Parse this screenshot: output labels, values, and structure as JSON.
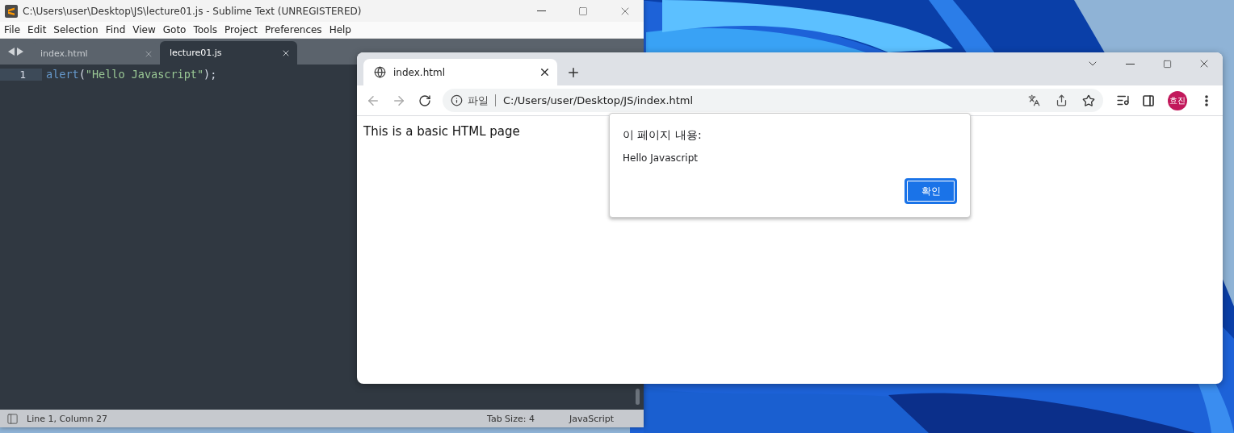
{
  "editor": {
    "title": "C:\\Users\\user\\Desktop\\JS\\lecture01.js - Sublime Text (UNREGISTERED)",
    "menu": [
      "File",
      "Edit",
      "Selection",
      "Find",
      "View",
      "Goto",
      "Tools",
      "Project",
      "Preferences",
      "Help"
    ],
    "tabs": [
      {
        "label": "index.html",
        "selected": false
      },
      {
        "label": "lecture01.js",
        "selected": true
      }
    ],
    "lines": [
      {
        "number": "1",
        "tokens": [
          {
            "kind": "function",
            "text": "alert"
          },
          {
            "kind": "punct",
            "text": "("
          },
          {
            "kind": "string",
            "text": "\"Hello Javascript\""
          },
          {
            "kind": "punct",
            "text": ");"
          }
        ]
      }
    ],
    "status": {
      "position": "Line 1, Column 27",
      "tab_size": "Tab Size: 4",
      "syntax": "JavaScript"
    }
  },
  "browser": {
    "tabs": [
      {
        "title": "index.html",
        "selected": true
      }
    ],
    "address": {
      "scheme": "파일",
      "url": "C:/Users/user/Desktop/JS/index.html"
    },
    "profile": "효진",
    "page_text": "This is a basic HTML page",
    "dialog": {
      "title": "이 페이지 내용:",
      "message": "Hello Javascript",
      "button": "확인"
    }
  }
}
